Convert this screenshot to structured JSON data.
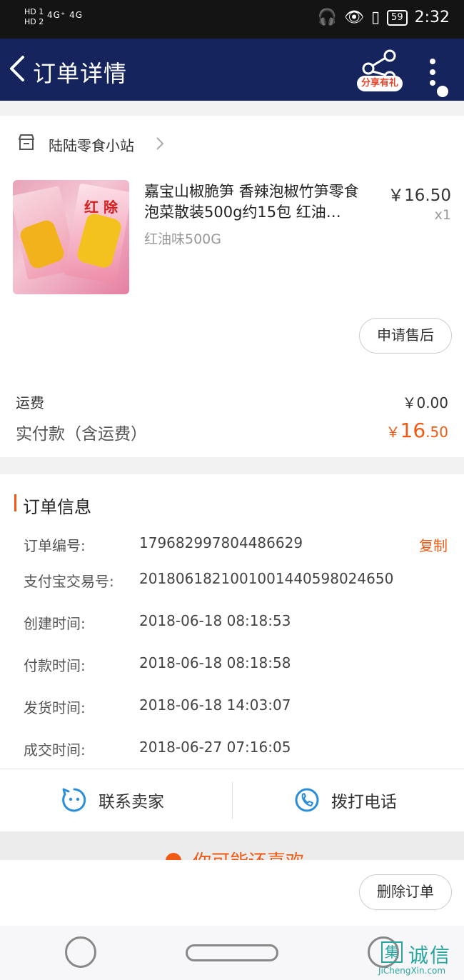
{
  "status_bar": {
    "sim1": "HD 1",
    "sim2": "HD 2",
    "network": "4G⁺ 4G",
    "battery": "59",
    "time": "2:32"
  },
  "nav": {
    "title": "订单详情",
    "share_badge": "分享有礼"
  },
  "shop": {
    "name": "陆陆零食小站"
  },
  "product": {
    "title": "嘉宝山椒脆笋 香辣泡椒竹笋零食泡菜散装500g约15包 红油…",
    "sku": "红油味500G",
    "price": "￥16.50",
    "qty": "x1",
    "image_label": "红 除",
    "aftersale_label": "申请售后"
  },
  "fees": {
    "shipping_label": "运费",
    "shipping_value": "￥0.00",
    "paid_label": "实付款（含运费）",
    "paid_currency": "￥",
    "paid_int": "16",
    "paid_dec": ".50"
  },
  "order_info": {
    "section_title": "订单信息",
    "copy_label": "复制",
    "rows": [
      {
        "label": "订单编号:",
        "value": "179682997804486629"
      },
      {
        "label": "支付宝交易号:",
        "value": "2018061821001001440598024650"
      },
      {
        "label": "创建时间:",
        "value": "2018-06-18 08:18:53"
      },
      {
        "label": "付款时间:",
        "value": "2018-06-18 08:18:58"
      },
      {
        "label": "发货时间:",
        "value": "2018-06-18 14:03:07"
      },
      {
        "label": "成交时间:",
        "value": "2018-06-27 07:16:05"
      }
    ]
  },
  "contact": {
    "seller_label": "联系卖家",
    "call_label": "拨打电话"
  },
  "recommend": {
    "text": "你可能还喜欢"
  },
  "footer": {
    "delete_label": "删除订单"
  },
  "watermark": {
    "box": "集",
    "chars": "诚信",
    "url": "JiChengXin.com"
  },
  "colors": {
    "nav_bg": "#16245e",
    "accent": "#f05a14",
    "icon_blue": "#2a8fd8"
  }
}
